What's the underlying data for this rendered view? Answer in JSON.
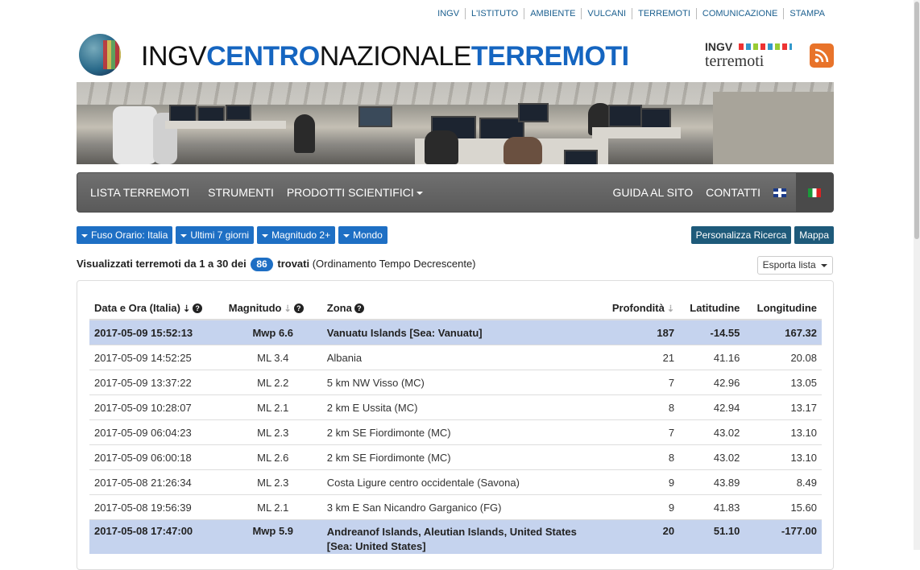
{
  "top_links": [
    "INGV",
    "L'ISTITUTO",
    "AMBIENTE",
    "VULCANI",
    "TERREMOTI",
    "COMUNICAZIONE",
    "STAMPA"
  ],
  "header": {
    "title_part1": "INGV",
    "title_part2": "CENTRO",
    "title_part3": "NAZIONALE",
    "title_part4": "TERREMOTI",
    "brand_line1": "INGV",
    "brand_line2": "terremoti"
  },
  "nav": {
    "left": [
      "LISTA TERREMOTI",
      "STRUMENTI",
      "PRODOTTI SCIENTIFICI"
    ],
    "right": [
      "GUIDA AL SITO",
      "CONTATTI"
    ]
  },
  "filters": [
    "Fuso Orario: Italia",
    "Ultimi 7 giorni",
    "Magnitudo 2+",
    "Mondo"
  ],
  "actions": [
    "Personalizza Ricerca",
    "Mappa"
  ],
  "summary": {
    "prefix": "Visualizzati terremoti da 1 a 30 dei",
    "count": "86",
    "found": "trovati",
    "order": "(Ordinamento Tempo Decrescente)"
  },
  "export_label": "Esporta lista",
  "table": {
    "headers": [
      "Data e Ora (Italia)",
      "Magnitudo",
      "Zona",
      "Profondità",
      "Latitudine",
      "Longitudine"
    ],
    "rows": [
      {
        "date": "2017-05-09 15:52:13",
        "mag": "Mwp 6.6",
        "zone": "Vanuatu Islands [Sea: Vanuatu]",
        "depth": "187",
        "lat": "-14.55",
        "lon": "167.32",
        "hl": true
      },
      {
        "date": "2017-05-09 14:52:25",
        "mag": "ML 3.4",
        "zone": "Albania",
        "depth": "21",
        "lat": "41.16",
        "lon": "20.08",
        "hl": false
      },
      {
        "date": "2017-05-09 13:37:22",
        "mag": "ML 2.2",
        "zone": "5 km NW Visso (MC)",
        "depth": "7",
        "lat": "42.96",
        "lon": "13.05",
        "hl": false
      },
      {
        "date": "2017-05-09 10:28:07",
        "mag": "ML 2.1",
        "zone": "2 km E Ussita (MC)",
        "depth": "8",
        "lat": "42.94",
        "lon": "13.17",
        "hl": false
      },
      {
        "date": "2017-05-09 06:04:23",
        "mag": "ML 2.3",
        "zone": "2 km SE Fiordimonte (MC)",
        "depth": "7",
        "lat": "43.02",
        "lon": "13.10",
        "hl": false
      },
      {
        "date": "2017-05-09 06:00:18",
        "mag": "ML 2.6",
        "zone": "2 km SE Fiordimonte (MC)",
        "depth": "8",
        "lat": "43.02",
        "lon": "13.10",
        "hl": false
      },
      {
        "date": "2017-05-08 21:26:34",
        "mag": "ML 2.3",
        "zone": "Costa Ligure centro occidentale (Savona)",
        "depth": "9",
        "lat": "43.89",
        "lon": "8.49",
        "hl": false
      },
      {
        "date": "2017-05-08 19:56:39",
        "mag": "ML 2.1",
        "zone": "3 km E San Nicandro Garganico (FG)",
        "depth": "9",
        "lat": "41.83",
        "lon": "15.60",
        "hl": false
      },
      {
        "date": "2017-05-08 17:47:00",
        "mag": "Mwp 5.9",
        "zone": "Andreanof Islands, Aleutian Islands, United States [Sea: United States]",
        "depth": "20",
        "lat": "51.10",
        "lon": "-177.00",
        "hl": true
      }
    ]
  },
  "colors": {
    "accent": "#1e6fc4",
    "highlight": "#c5d3ee",
    "navbar": "#5a5a5a",
    "title_blue": "#1565c0"
  }
}
